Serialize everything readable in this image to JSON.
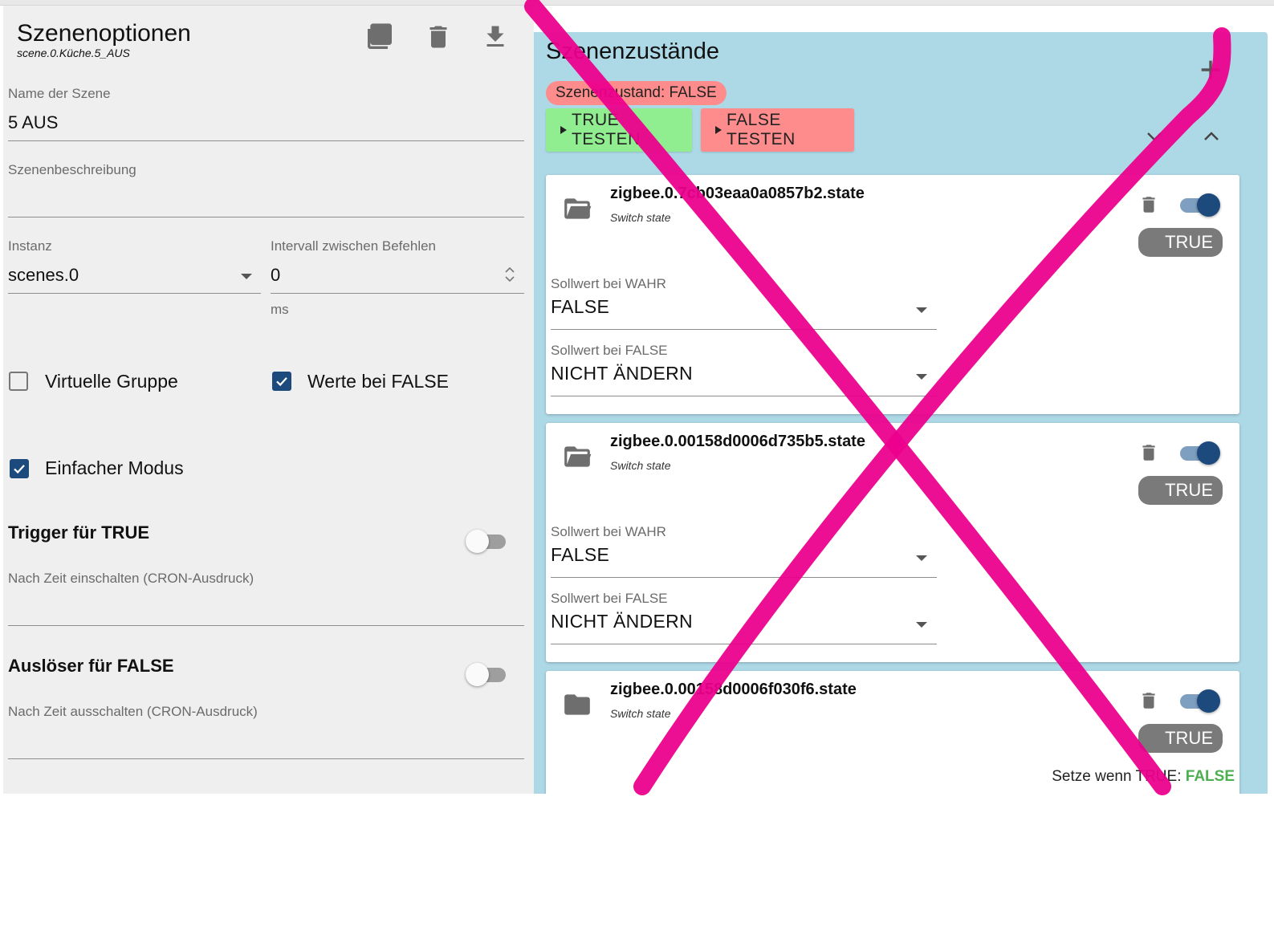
{
  "left": {
    "title": "Szenenoptionen",
    "subtitle": "scene.0.Küche.5_AUS",
    "icons": [
      "copy-icon",
      "delete-icon",
      "download-icon"
    ],
    "name_label": "Name der Szene",
    "name_value": "5 AUS",
    "description_label": "Szenenbeschreibung",
    "description_value": "",
    "instance_label": "Instanz",
    "instance_value": "scenes.0",
    "interval_label": "Intervall zwischen Befehlen",
    "interval_value": "0",
    "interval_unit": "ms",
    "virtual_group_label": "Virtuelle Gruppe",
    "virtual_group_checked": false,
    "values_false_label": "Werte bei FALSE",
    "values_false_checked": true,
    "simple_mode_label": "Einfacher Modus",
    "simple_mode_checked": true,
    "trigger_true_title": "Trigger für TRUE",
    "trigger_true_enabled": false,
    "cron_true_label": "Nach Zeit einschalten (CRON-Ausdruck)",
    "trigger_false_title": "Auslöser für FALSE",
    "trigger_false_enabled": false,
    "cron_false_label": "Nach Zeit ausschalten (CRON-Ausdruck)"
  },
  "right": {
    "title": "Szenenzustände",
    "add_icon": "plus-icon",
    "state_chip": "Szenenzustand: FALSE",
    "test_true_label": "TRUE TESTEN",
    "test_false_label": "FALSE TESTEN",
    "colors": {
      "panel": "#add8e6",
      "test_true": "#90ee90",
      "test_false": "#ff8c8c",
      "overlay_x": "#ec008c",
      "false_value": "#4caf50"
    },
    "cards": [
      {
        "name": "zigbee.0.7cb03eaa0a0857b2.state",
        "desc": "Switch state",
        "folder_icon": "folder-open-icon",
        "enabled": true,
        "badge": "TRUE",
        "field1_label": "Sollwert bei WAHR",
        "field1_value": "FALSE",
        "field2_label": "Sollwert bei FALSE",
        "field2_value": "NICHT ÄNDERN"
      },
      {
        "name": "zigbee.0.00158d0006d735b5.state",
        "desc": "Switch state",
        "folder_icon": "folder-open-icon",
        "enabled": true,
        "badge": "TRUE",
        "field1_label": "Sollwert bei WAHR",
        "field1_value": "FALSE",
        "field2_label": "Sollwert bei FALSE",
        "field2_value": "NICHT ÄNDERN"
      },
      {
        "name": "zigbee.0.00158d0006f030f6.state",
        "desc": "Switch state",
        "folder_icon": "folder-icon",
        "enabled": true,
        "badge": "TRUE",
        "summary_prefix": "Setze wenn TRUE:",
        "summary_value": "FALSE"
      }
    ]
  }
}
